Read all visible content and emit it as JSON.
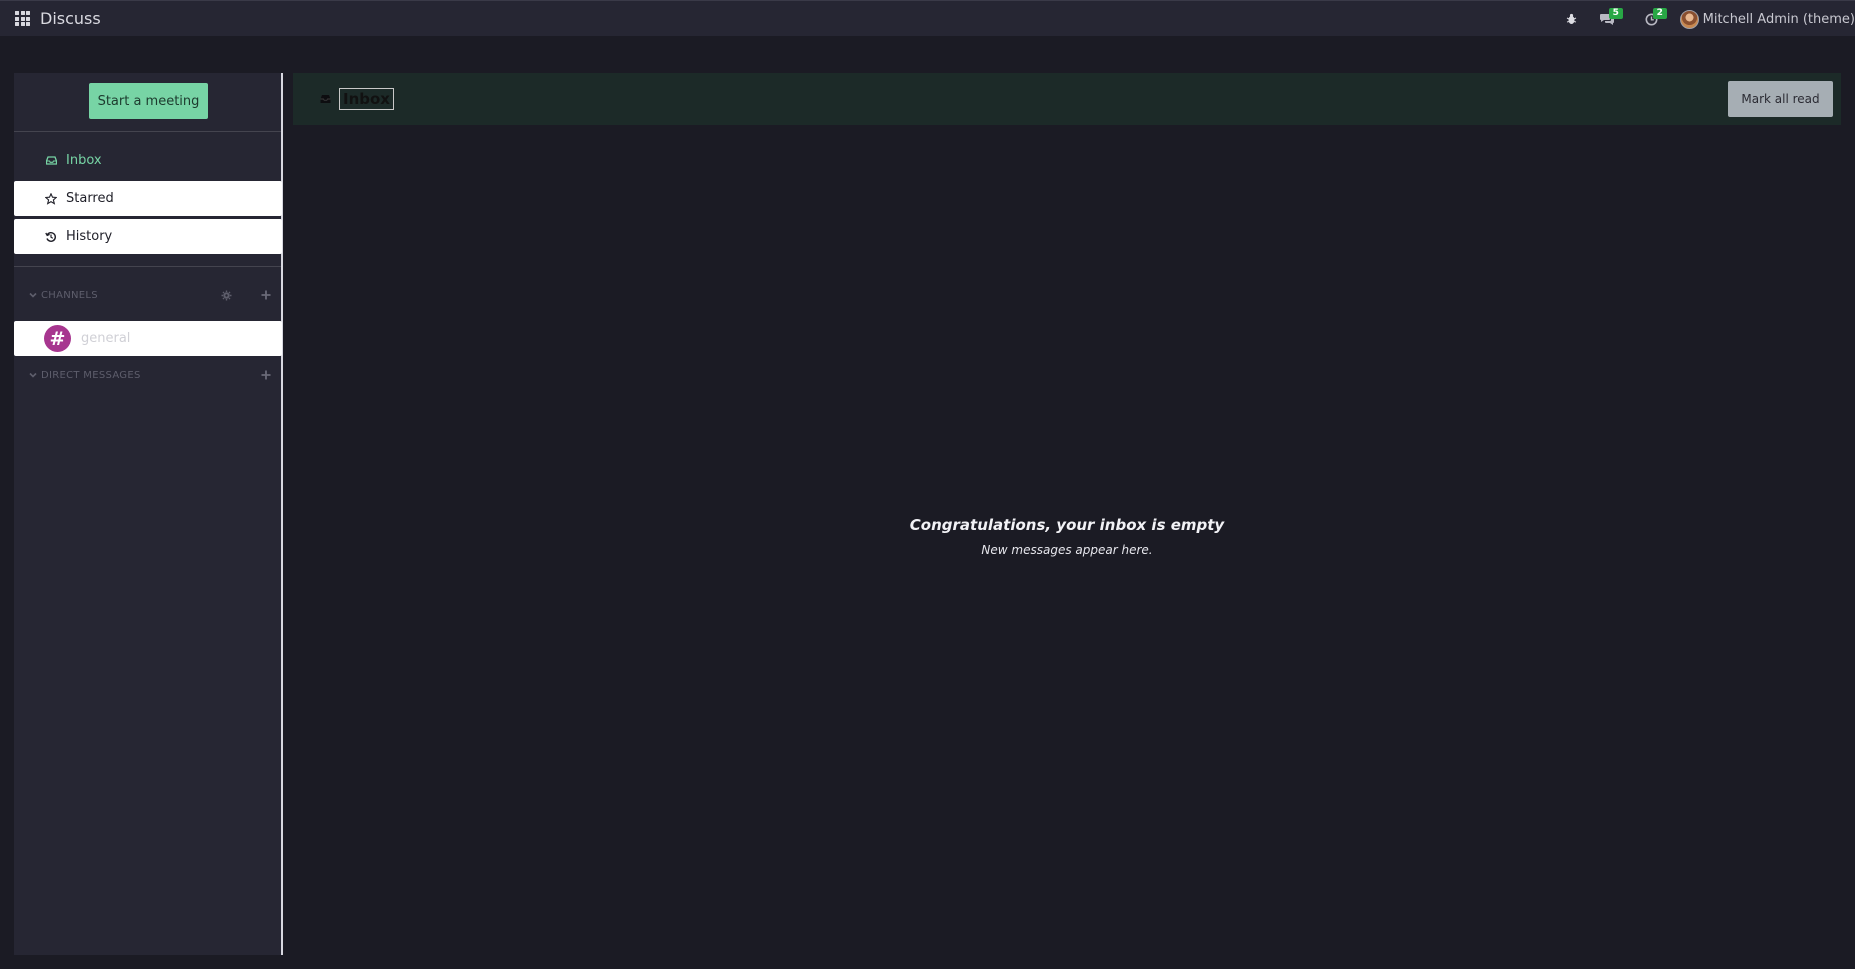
{
  "navbar": {
    "app_title": "Discuss",
    "messages_badge": "5",
    "activities_badge": "2",
    "user_name": "Mitchell Admin (theme)"
  },
  "sidebar": {
    "start_meeting_label": "Start a meeting",
    "mailboxes": [
      {
        "label": "Inbox",
        "icon": "inbox-icon"
      },
      {
        "label": "Starred",
        "icon": "star-icon"
      },
      {
        "label": "History",
        "icon": "history-icon"
      }
    ],
    "channels_header": "CHANNELS",
    "channels": [
      {
        "name": "general",
        "avatar_glyph": "#"
      }
    ],
    "direct_messages_header": "DIRECT MESSAGES"
  },
  "thread": {
    "name": "Inbox",
    "mark_all_read_label": "Mark all read",
    "empty_title": "Congratulations, your inbox is empty",
    "empty_subtitle": "New messages appear here."
  },
  "colors": {
    "background": "#1b1b24",
    "navbar": "#262633",
    "accent": "#77d4a5",
    "channel_avatar": "#a7368f",
    "badge": "#28a745"
  }
}
